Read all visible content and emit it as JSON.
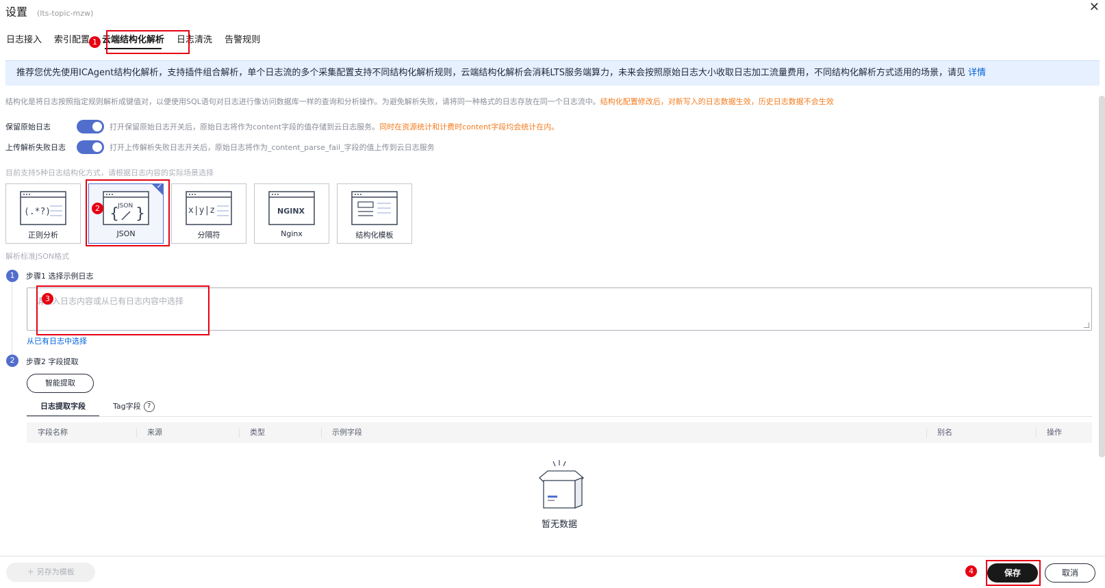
{
  "header": {
    "title": "设置",
    "subtitle": "(lts-topic-mzw)"
  },
  "tabs": [
    {
      "label": "日志接入"
    },
    {
      "label": "索引配置"
    },
    {
      "label": "云端结构化解析"
    },
    {
      "label": "日志清洗"
    },
    {
      "label": "告警规则"
    }
  ],
  "notice": {
    "text": "推荐您优先使用ICAgent结构化解析，支持插件组合解析，单个日志流的多个采集配置支持不同结构化解析规则，云端结构化解析会消耗LTS服务端算力，未来会按照原始日志大小收取日志加工流量费用，不同结构化解析方式适用的场景，请见",
    "link": "详情"
  },
  "description": {
    "text": "结构化是将日志按照指定规则解析成键值对，以便使用SQL语句对日志进行像访问数据库一样的查询和分析操作。为避免解析失败，请将同一种格式的日志存放在同一个日志流中。",
    "warning": "结构化配置修改后，对新写入的日志数据生效，历史日志数据不会生效"
  },
  "toggles": {
    "keep_raw": {
      "label": "保留原始日志",
      "hint": "打开保留原始日志开关后，原始日志将作为content字段的值存储到云日志服务。",
      "warning": "同时在资源统计和计费时content字段均会统计在内。",
      "on": true
    },
    "upload_fail": {
      "label": "上传解析失败日志",
      "hint": "打开上传解析失败日志开关后，原始日志将作为_content_parse_fail_字段的值上传到云日志服务",
      "on": true
    }
  },
  "methods_hint": "目前支持5种日志结构化方式，请根据日志内容的实际场景选择",
  "methods": [
    {
      "label": "正则分析",
      "icon": "regex-icon",
      "glyph": "(.*?)"
    },
    {
      "label": "JSON",
      "icon": "json-icon",
      "glyph": "JSON",
      "selected": true
    },
    {
      "label": "分隔符",
      "icon": "delimiter-icon",
      "glyph": "x|y|z"
    },
    {
      "label": "Nginx",
      "icon": "nginx-icon",
      "glyph": "NGINX"
    },
    {
      "label": "结构化模板",
      "icon": "template-icon",
      "glyph": ""
    }
  ],
  "parse_hint": "解析标准JSON格式",
  "step1": {
    "num": "1",
    "label": "步骤1 选择示例日志",
    "placeholder": "请输入日志内容或从已有日志内容中选择",
    "link": "从已有日志中选择"
  },
  "step2": {
    "num": "2",
    "label": "步骤2 字段提取",
    "button": "智能提取"
  },
  "subtabs": [
    {
      "label": "日志提取字段"
    },
    {
      "label": "Tag字段"
    }
  ],
  "table": {
    "columns": [
      "字段名称",
      "来源",
      "类型",
      "示例字段",
      "别名",
      "操作"
    ],
    "empty": "暂无数据"
  },
  "footer": {
    "save_template": "另存为模板",
    "save": "保存",
    "cancel": "取消"
  },
  "annotations": [
    "1",
    "2",
    "3",
    "4"
  ],
  "colors": {
    "accent": "#526ecc",
    "annotation": "#e60012",
    "notice_bg": "#e6f0ff",
    "link": "#0062d9",
    "warning": "#f37b1d"
  }
}
